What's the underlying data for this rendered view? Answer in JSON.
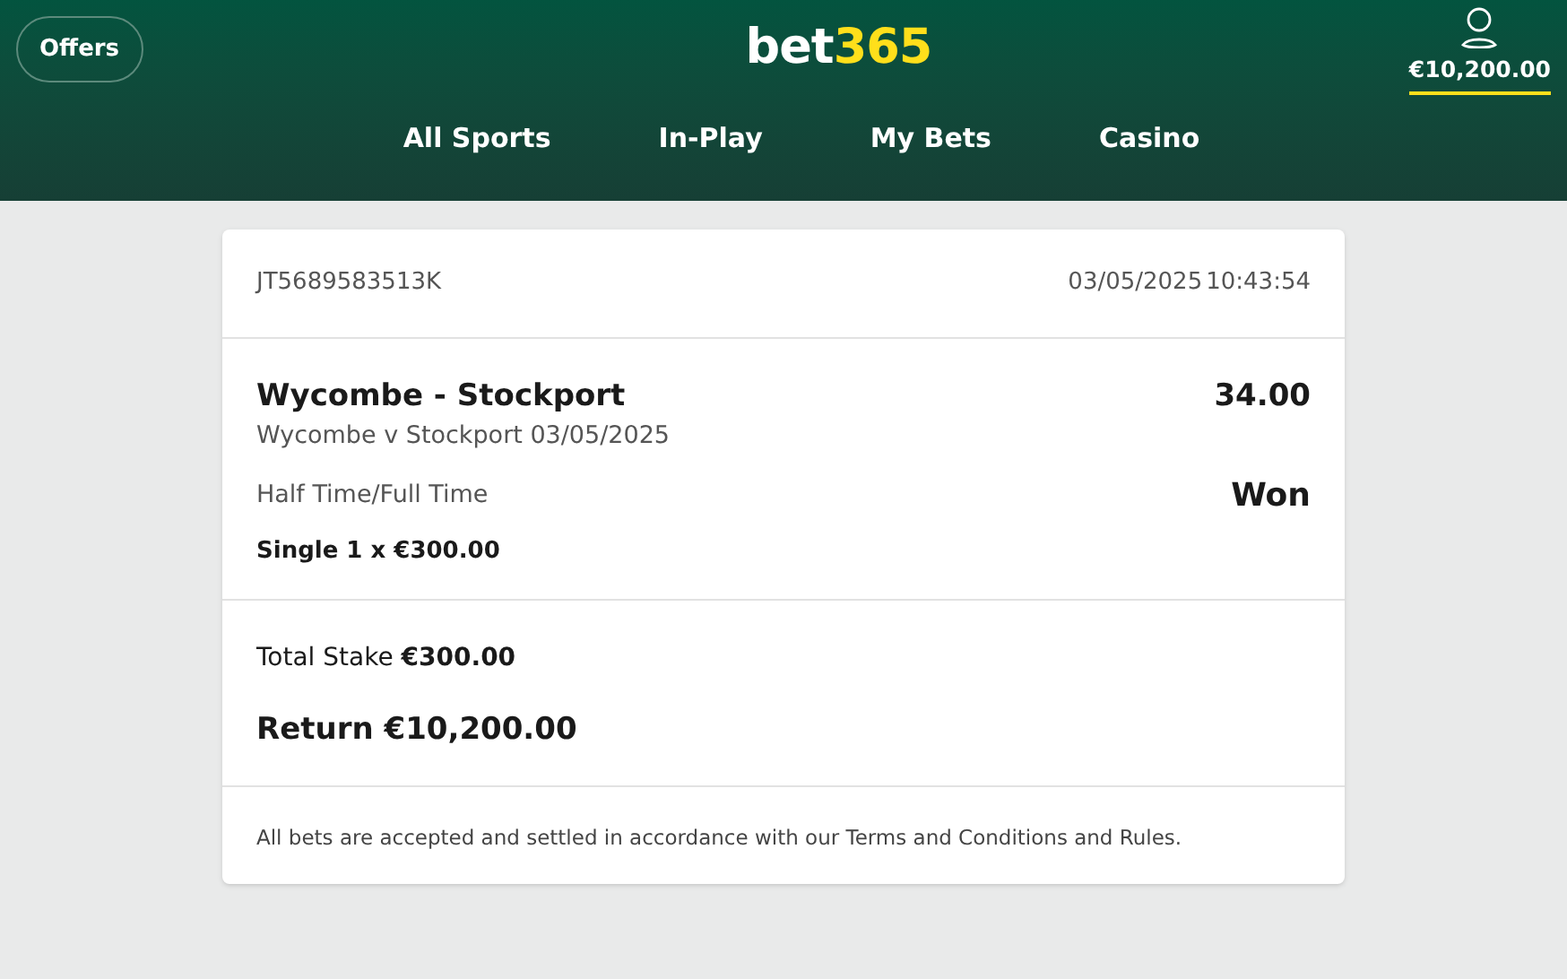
{
  "header": {
    "offers_button": "Offers",
    "logo": {
      "part_1": "bet",
      "part_2": "365"
    },
    "balance": "€10,200.00"
  },
  "nav": [
    {
      "label": "All Sports"
    },
    {
      "label": "In-Play"
    },
    {
      "label": "My Bets"
    },
    {
      "label": "Casino"
    }
  ],
  "bet": {
    "reference": "JT5689583513K",
    "date": "03/05/2025",
    "time": "10:43:54",
    "selection": "Wycombe - Stockport",
    "odds": "34.00",
    "event": "Wycombe v Stockport 03/05/2025",
    "market": "Half Time/Full Time",
    "result": "Won",
    "bet_type": "Single 1 x €300.00",
    "total_stake": "Total Stake **€300.00**",
    "return": "Return €10,200.00",
    "disclaimer": "All bets are accepted and settled in accordance with our Terms and Conditions and Rules."
  }
}
